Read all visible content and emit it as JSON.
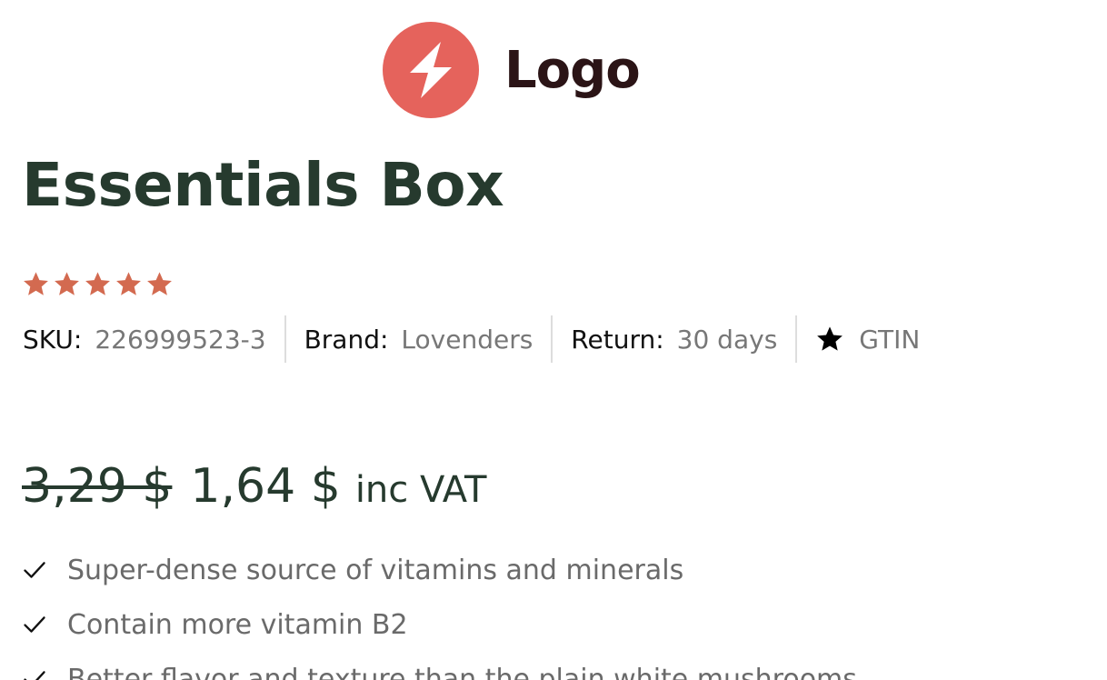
{
  "brand": {
    "logo_text": "Logo",
    "logo_icon": "bolt-icon",
    "logo_color": "#e5635c",
    "logo_text_color": "#2b1416"
  },
  "product": {
    "title": "Essentials Box",
    "rating": 5,
    "rating_max": 5,
    "star_color": "#d36a50",
    "title_color": "#263a2e"
  },
  "meta": {
    "sku_label": "SKU:",
    "sku_value": "226999523-3",
    "brand_label": "Brand:",
    "brand_value": "Lovenders",
    "return_label": "Return:",
    "return_value": "30 days",
    "gtin_icon": "star-icon",
    "gtin_value": "GTIN"
  },
  "price": {
    "old": "3,29 $",
    "new": "1,64 $",
    "tax_note": "inc VAT"
  },
  "features": [
    "Super-dense source of vitamins and minerals",
    "Contain more vitamin B2",
    "Better flavor and texture than the plain white mushrooms"
  ]
}
